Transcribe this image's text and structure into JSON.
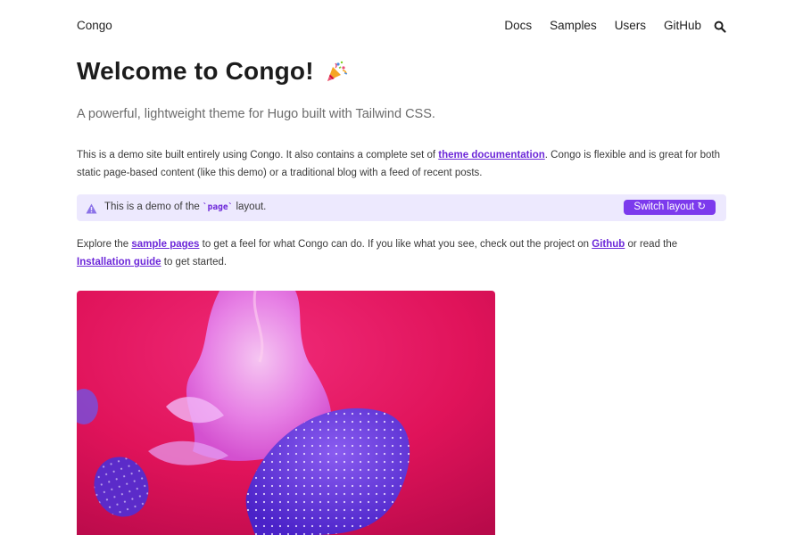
{
  "header": {
    "brand": "Congo",
    "nav": [
      "Docs",
      "Samples",
      "Users",
      "GitHub"
    ],
    "search_icon": "search-icon"
  },
  "main": {
    "title": "Welcome to Congo!",
    "title_icon": "party-popper-icon",
    "lead": "A powerful, lightweight theme for Hugo built with Tailwind CSS.",
    "intro": {
      "before": "This is a demo site built entirely using Congo. It also contains a complete set of ",
      "link": "theme documentation",
      "after": ". Congo is flexible and is great for both static page-based content (like this demo) or a traditional blog with a feed of recent posts."
    },
    "callout": {
      "icon": "warning-triangle-icon",
      "text_before": "This is a demo of the ",
      "code": "`page`",
      "text_after": " layout.",
      "button": "Switch layout ↻"
    },
    "explore": {
      "t1": "Explore the ",
      "link1": "sample pages",
      "t2": " to get a feel for what Congo can do. If you like what you see, check out the project on ",
      "link2": "Github",
      "t3": " or read the ",
      "link3": "Installation guide",
      "t4": " to get started."
    },
    "hero_image": "jellyfish-photo"
  },
  "colors": {
    "accent": "#7c3aed",
    "accent_text": "#6d28d9",
    "callout_bg": "#ede9fe",
    "hero_pink": "#e8175d"
  }
}
